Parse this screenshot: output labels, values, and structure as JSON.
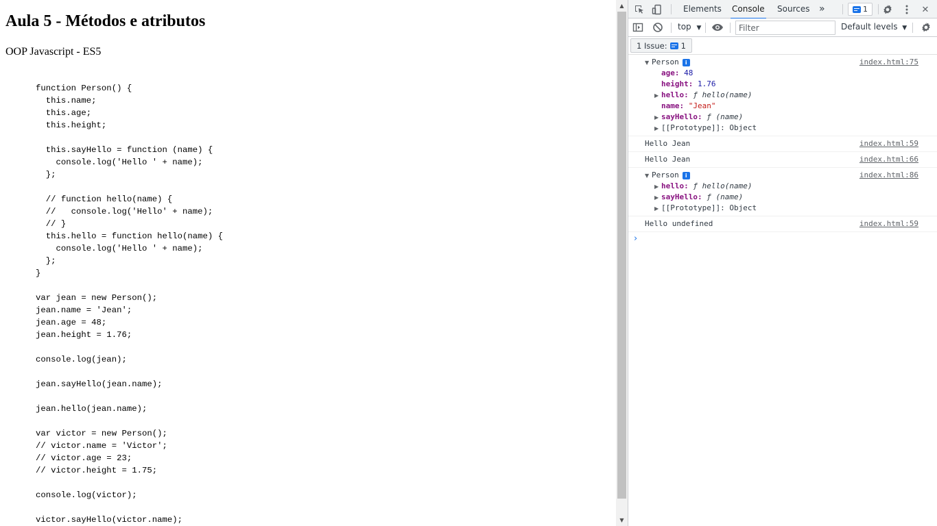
{
  "page": {
    "title": "Aula 5 - Métodos e atributos",
    "subtitle": "OOP Javascript - ES5",
    "code_lines": [
      "function Person() {",
      "  this.name;",
      "  this.age;",
      "  this.height;",
      "",
      "  this.sayHello = function (name) {",
      "    console.log('Hello ' + name);",
      "  };",
      "",
      "  // function hello(name) {",
      "  //   console.log('Hello' + name);",
      "  // }",
      "  this.hello = function hello(name) {",
      "    console.log('Hello ' + name);",
      "  };",
      "}",
      "",
      "var jean = new Person();",
      "jean.name = 'Jean';",
      "jean.age = 48;",
      "jean.height = 1.76;",
      "",
      "console.log(jean);",
      "",
      "jean.sayHello(jean.name);",
      "",
      "jean.hello(jean.name);",
      "",
      "var victor = new Person();",
      "// victor.name = 'Victor';",
      "// victor.age = 23;",
      "// victor.height = 1.75;",
      "",
      "console.log(victor);",
      "",
      "victor.sayHello(victor.name);"
    ]
  },
  "devtools": {
    "tabs": {
      "elements": "Elements",
      "console": "Console",
      "sources": "Sources",
      "more": "»"
    },
    "issues_badge_count": "1",
    "toolbar": {
      "context": "top",
      "filter_placeholder": "Filter",
      "levels": "Default levels"
    },
    "issues_bar": {
      "label": "1 Issue:",
      "count": "1"
    },
    "console": {
      "msg1": {
        "label": "Person",
        "info": "i",
        "source": "index.html:75",
        "age_key": "age",
        "age_val": "48",
        "height_key": "height",
        "height_val": "1.76",
        "hello_key": "hello",
        "hello_val": "ƒ hello(name)",
        "name_key": "name",
        "name_val": "\"Jean\"",
        "sayhello_key": "sayHello",
        "sayhello_val": "ƒ (name)",
        "proto_key": "[[Prototype]]",
        "proto_val": "Object"
      },
      "msg2": {
        "text": "Hello Jean",
        "source": "index.html:59"
      },
      "msg3": {
        "text": "Hello Jean",
        "source": "index.html:66"
      },
      "msg4": {
        "label": "Person",
        "info": "i",
        "source": "index.html:86",
        "hello_key": "hello",
        "hello_val": "ƒ hello(name)",
        "sayhello_key": "sayHello",
        "sayhello_val": "ƒ (name)",
        "proto_key": "[[Prototype]]",
        "proto_val": "Object"
      },
      "msg5": {
        "text": "Hello undefined",
        "source": "index.html:59"
      },
      "prompt": "›"
    }
  }
}
